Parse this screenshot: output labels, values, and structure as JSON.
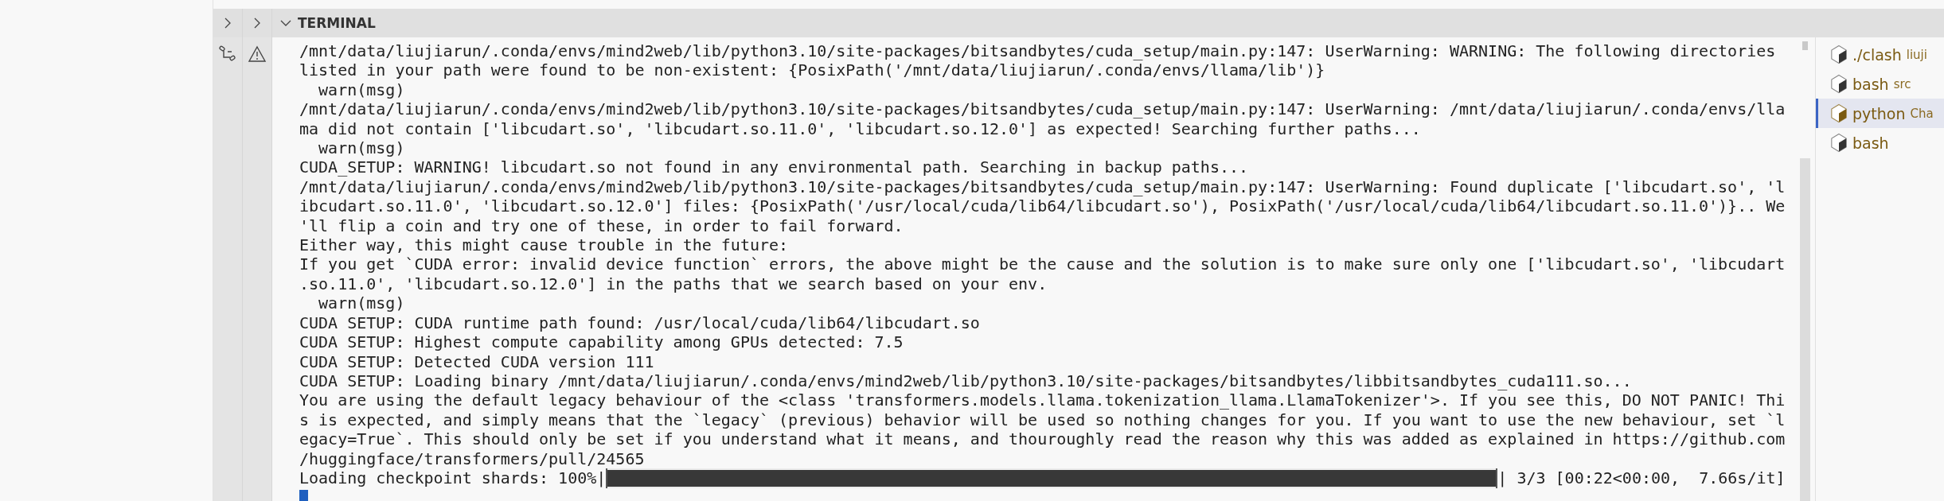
{
  "panel_header": {
    "title": "TERMINAL",
    "expanded": true
  },
  "terminal": {
    "lines": [
      "/mnt/data/liujiarun/.conda/envs/mind2web/lib/python3.10/site-packages/bitsandbytes/cuda_setup/main.py:147: UserWarning: WARNING: The following directories",
      "listed in your path were found to be non-existent: {PosixPath('/mnt/data/liujiarun/.conda/envs/llama/lib')}",
      "  warn(msg)",
      "/mnt/data/liujiarun/.conda/envs/mind2web/lib/python3.10/site-packages/bitsandbytes/cuda_setup/main.py:147: UserWarning: /mnt/data/liujiarun/.conda/envs/lla",
      "ma did not contain ['libcudart.so', 'libcudart.so.11.0', 'libcudart.so.12.0'] as expected! Searching further paths...",
      "  warn(msg)",
      "CUDA_SETUP: WARNING! libcudart.so not found in any environmental path. Searching in backup paths...",
      "/mnt/data/liujiarun/.conda/envs/mind2web/lib/python3.10/site-packages/bitsandbytes/cuda_setup/main.py:147: UserWarning: Found duplicate ['libcudart.so', 'l",
      "ibcudart.so.11.0', 'libcudart.so.12.0'] files: {PosixPath('/usr/local/cuda/lib64/libcudart.so'), PosixPath('/usr/local/cuda/lib64/libcudart.so.11.0')}.. We",
      "'ll flip a coin and try one of these, in order to fail forward.",
      "Either way, this might cause trouble in the future:",
      "If you get `CUDA error: invalid device function` errors, the above might be the cause and the solution is to make sure only one ['libcudart.so', 'libcudart",
      ".so.11.0', 'libcudart.so.12.0'] in the paths that we search based on your env.",
      "  warn(msg)",
      "CUDA SETUP: CUDA runtime path found: /usr/local/cuda/lib64/libcudart.so",
      "CUDA SETUP: Highest compute capability among GPUs detected: 7.5",
      "CUDA SETUP: Detected CUDA version 111",
      "CUDA SETUP: Loading binary /mnt/data/liujiarun/.conda/envs/mind2web/lib/python3.10/site-packages/bitsandbytes/libbitsandbytes_cuda111.so...",
      "You are using the default legacy behaviour of the <class 'transformers.models.llama.tokenization_llama.LlamaTokenizer'>. If you see this, DO NOT PANIC! Thi",
      "s is expected, and simply means that the `legacy` (previous) behavior will be used so nothing changes for you. If you want to use the new behaviour, set `l",
      "egacy=True`. This should only be set if you understand what it means, and thouroughly read the reason why this was added as explained in https://github.com",
      "/huggingface/transformers/pull/24565"
    ],
    "progress": {
      "label": "Loading checkpoint shards: 100%|",
      "level": 1,
      "suffix": "| 3/3 [00:22<00:00,  7.66s/it]"
    },
    "cursor_visible": true
  },
  "terminal_list": [
    {
      "name": "./clash",
      "detail": "liuji",
      "selected": false
    },
    {
      "name": "bash",
      "detail": "src",
      "selected": false
    },
    {
      "name": "python",
      "detail": "Cha",
      "selected": true
    },
    {
      "name": "bash",
      "selected": false
    }
  ]
}
